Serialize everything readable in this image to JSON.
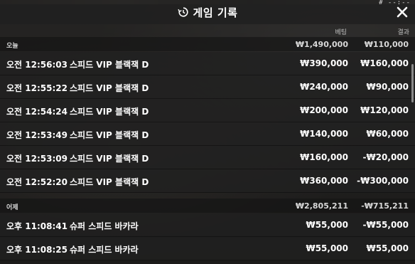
{
  "header": {
    "title": "게임 기록",
    "icon": "history-icon",
    "close_icon": "close-icon",
    "readout": "# --:--"
  },
  "columns": {
    "bet": "베팅",
    "result": "결과"
  },
  "groups": [
    {
      "label": "오늘",
      "bet_total": "₩1,490,000",
      "result_total": "₩110,000",
      "rows": [
        {
          "time": "오전 12:56:03",
          "game": "스피드 VIP 블랙잭 D",
          "bet": "₩390,000",
          "result": "₩160,000"
        },
        {
          "time": "오전 12:55:22",
          "game": "스피드 VIP 블랙잭 D",
          "bet": "₩240,000",
          "result": "₩90,000"
        },
        {
          "time": "오전 12:54:24",
          "game": "스피드 VIP 블랙잭 D",
          "bet": "₩200,000",
          "result": "₩120,000"
        },
        {
          "time": "오전 12:53:49",
          "game": "스피드 VIP 블랙잭 D",
          "bet": "₩140,000",
          "result": "₩60,000"
        },
        {
          "time": "오전 12:53:09",
          "game": "스피드 VIP 블랙잭 D",
          "bet": "₩160,000",
          "result": "-₩20,000"
        },
        {
          "time": "오전 12:52:20",
          "game": "스피드 VIP 블랙잭 D",
          "bet": "₩360,000",
          "result": "-₩300,000"
        }
      ]
    },
    {
      "label": "어제",
      "bet_total": "₩2,805,211",
      "result_total": "-₩715,211",
      "rows": [
        {
          "time": "오후 11:08:41",
          "game": "슈퍼 스피드 바카라",
          "bet": "₩55,000",
          "result": "-₩55,000"
        },
        {
          "time": "오후 11:08:25",
          "game": "슈퍼 스피드 바카라",
          "bet": "₩55,000",
          "result": "₩55,000"
        }
      ]
    }
  ]
}
